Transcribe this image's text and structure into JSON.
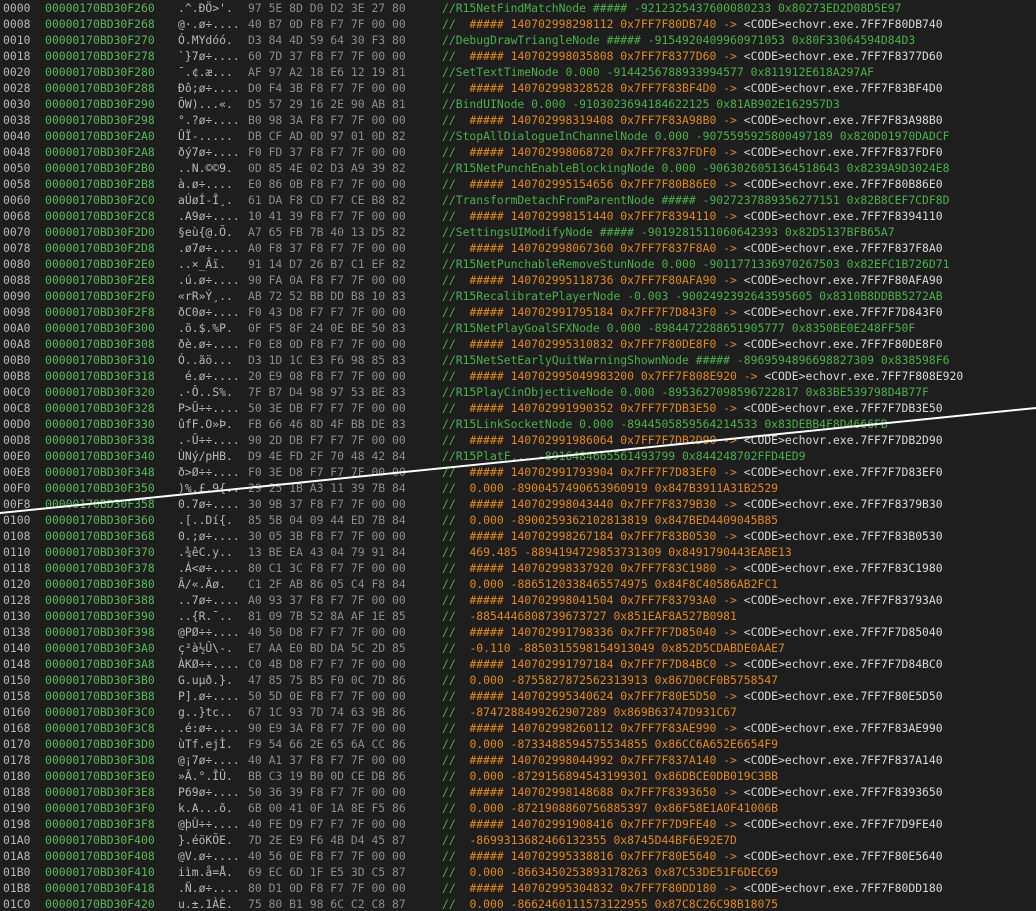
{
  "colors": {
    "background": "#1e1e1e",
    "offset": "#b8b8b8",
    "address": "#59b85b",
    "ascii": "#b8b8b8",
    "hex": "#8c8c8c",
    "comment_green": "#4cb04a",
    "comment_orange": "#e0891e",
    "comment_white": "#d9d9d9",
    "overlay_line": "#ffffff"
  },
  "rows": [
    {
      "off": "0000",
      "addr": "00000170BD30F260",
      "ascii": ".^.ĐÖ>'.",
      "hex": "97 5E 8D D0 D2 3E 27 80",
      "cmt": [
        [
          "//R15NetFindMatchNode ##### -9212325437600080233 0x80273ED2D08D5E97",
          "g"
        ]
      ]
    },
    {
      "off": "0008",
      "addr": "00000170BD30F268",
      "ascii": "@·.ø÷....",
      "hex": "40 B7 0D F8 F7 7F 00 00",
      "cmt": [
        [
          "//  ",
          "g"
        ],
        [
          "##### 140702998298112 0x7FF7F80DB740 -> ",
          "o"
        ],
        [
          "<CODE>echovr.exe.7FF7F80DB740",
          "w"
        ]
      ]
    },
    {
      "off": "0010",
      "addr": "00000170BD30F270",
      "ascii": "Ó.MYdóó.",
      "hex": "D3 84 4D 59 64 30 F3 80",
      "cmt": [
        [
          "//DebugDrawTriangleNode ##### -9154920409960971053 0x80F33064594D84D3",
          "g"
        ]
      ]
    },
    {
      "off": "0018",
      "addr": "00000170BD30F278",
      "ascii": "`}7ø÷....",
      "hex": "60 7D 37 F8 F7 7F 00 00",
      "cmt": [
        [
          "//  ",
          "g"
        ],
        [
          "##### 140702998035808 0x7FF7F8377D60 -> ",
          "o"
        ],
        [
          "<CODE>echovr.exe.7FF7F8377D60",
          "w"
        ]
      ]
    },
    {
      "off": "0020",
      "addr": "00000170BD30F280",
      "ascii": "¯.¢.æ...",
      "hex": "AF 97 A2 18 E6 12 19 81",
      "cmt": [
        [
          "//SetTextTimeNode 0.000 -9144256788933994577 0x811912E618A297AF",
          "g"
        ]
      ]
    },
    {
      "off": "0028",
      "addr": "00000170BD30F288",
      "ascii": "Ðô;ø÷....",
      "hex": "D0 F4 3B F8 F7 7F 00 00",
      "cmt": [
        [
          "//  ",
          "g"
        ],
        [
          "##### 140702998328528 0x7FF7F83BF4D0 -> ",
          "o"
        ],
        [
          "<CODE>echovr.exe.7FF7F83BF4D0",
          "w"
        ]
      ]
    },
    {
      "off": "0030",
      "addr": "00000170BD30F290",
      "ascii": "ÕW)...«.",
      "hex": "D5 57 29 16 2E 90 AB 81",
      "cmt": [
        [
          "//BindUINode 0.000 -9103023694184622125 0x81AB902E162957D3",
          "g"
        ]
      ]
    },
    {
      "off": "0038",
      "addr": "00000170BD30F298",
      "ascii": "°.?ø÷....",
      "hex": "B0 98 3A F8 F7 7F 00 00",
      "cmt": [
        [
          "//  ",
          "g"
        ],
        [
          "##### 140702998319408 0x7FF7F83A98B0 -> ",
          "o"
        ],
        [
          "<CODE>echovr.exe.7FF7F83A98B0",
          "w"
        ]
      ]
    },
    {
      "off": "0040",
      "addr": "00000170BD30F2A0",
      "ascii": "ÛÏ-.....",
      "hex": "DB CF AD 0D 97 01 0D 82",
      "cmt": [
        [
          "//StopAllDialogueInChannelNode 0.000 -9075595925800497189 0x820D01970DADCF",
          "g"
        ]
      ]
    },
    {
      "off": "0048",
      "addr": "00000170BD30F2A8",
      "ascii": "ðý7ø÷....",
      "hex": "F0 FD 37 F8 F7 7F 00 00",
      "cmt": [
        [
          "//  ",
          "g"
        ],
        [
          "##### 140702998068720 0x7FF7F837FDF0 -> ",
          "o"
        ],
        [
          "<CODE>echovr.exe.7FF7F837FDF0",
          "w"
        ]
      ]
    },
    {
      "off": "0050",
      "addr": "00000170BD30F2B0",
      "ascii": "..N.©©9.",
      "hex": "0D 85 4E 02 D3 A9 39 82",
      "cmt": [
        [
          "//R15NetPunchEnableBlockingNode 0.000 -9063026051364518643 0x8239A9D3024E8",
          "g"
        ]
      ]
    },
    {
      "off": "0058",
      "addr": "00000170BD30F2B8",
      "ascii": "à.ø÷....",
      "hex": "E0 86 0B F8 F7 7F 00 00",
      "cmt": [
        [
          "//  ",
          "g"
        ],
        [
          "##### 140702995154656 0x7FF7F80B86E0 -> ",
          "o"
        ],
        [
          "<CODE>echovr.exe.7FF7F80B86E0",
          "w"
        ]
      ]
    },
    {
      "off": "0060",
      "addr": "00000170BD30F2C0",
      "ascii": "aÚøÍ-Î¸.",
      "hex": "61 DA F8 CD F7 CE B8 82",
      "cmt": [
        [
          "//TransformDetachFromParentNode ##### -9027237889356277151 0x82B8CEF7CDF8D",
          "g"
        ]
      ]
    },
    {
      "off": "0068",
      "addr": "00000170BD30F2C8",
      "ascii": ".A9ø÷....",
      "hex": "10 41 39 F8 F7 7F 00 00",
      "cmt": [
        [
          "//  ",
          "g"
        ],
        [
          "##### 140702998151440 0x7FF7F8394110 -> ",
          "o"
        ],
        [
          "<CODE>echovr.exe.7FF7F8394110",
          "w"
        ]
      ]
    },
    {
      "off": "0070",
      "addr": "00000170BD30F2D0",
      "ascii": "§eù{@.Õ.",
      "hex": "A7 65 FB 7B 40 13 D5 82",
      "cmt": [
        [
          "//SettingsUIModifyNode ##### -9019281511060642393 0x82D5137BFB65A7",
          "g"
        ]
      ]
    },
    {
      "off": "0078",
      "addr": "00000170BD30F2D8",
      "ascii": ".ø7ø÷....",
      "hex": "A0 F8 37 F8 F7 7F 00 00",
      "cmt": [
        [
          "//  ",
          "g"
        ],
        [
          "##### 140702998067360 0x7FF7F837F8A0 -> ",
          "o"
        ],
        [
          "<CODE>echovr.exe.7FF7F837F8A0",
          "w"
        ]
      ]
    },
    {
      "off": "0080",
      "addr": "00000170BD30F2E0",
      "ascii": "..×_Âï.",
      "hex": "91 14 D7 26 B7 C1 EF 82",
      "cmt": [
        [
          "//R15NetPunchableRemoveStunNode 0.000 -9011771336970267503 0x82EFC1B726D71",
          "g"
        ]
      ]
    },
    {
      "off": "0088",
      "addr": "00000170BD30F2E8",
      "ascii": ".ú.ø÷....",
      "hex": "90 FA 0A F8 F7 7F 00 00",
      "cmt": [
        [
          "//  ",
          "g"
        ],
        [
          "##### 140702995118736 0x7FF7F80AFA90 -> ",
          "o"
        ],
        [
          "<CODE>echovr.exe.7FF7F80AFA90",
          "w"
        ]
      ]
    },
    {
      "off": "0090",
      "addr": "00000170BD30F2F0",
      "ascii": "«rR»Ý¸..",
      "hex": "AB 72 52 BB DD B8 10 83",
      "cmt": [
        [
          "//R15RecalibratePlayerNode -0.003 -9002492392643595605 0x8310B8DDBB5272AB",
          "g"
        ]
      ]
    },
    {
      "off": "0098",
      "addr": "00000170BD30F2F8",
      "ascii": "ðC0ø÷....",
      "hex": "F0 43 D8 F7 F7 7F 00 00",
      "cmt": [
        [
          "//  ",
          "g"
        ],
        [
          "##### 140702991795184 0x7FF7F7D843F0 -> ",
          "o"
        ],
        [
          "<CODE>echovr.exe.7FF7F7D843F0",
          "w"
        ]
      ]
    },
    {
      "off": "00A0",
      "addr": "00000170BD30F300",
      "ascii": ".õ.$.%P.",
      "hex": "0F F5 8F 24 0E BE 50 83",
      "cmt": [
        [
          "//R15NetPlayGoalSFXNode 0.000 -8984472288651905777 0x8350BE0E248FF50F",
          "g"
        ]
      ]
    },
    {
      "off": "00A8",
      "addr": "00000170BD30F308",
      "ascii": "ðè.ø÷....",
      "hex": "F0 E8 0D F8 F7 7F 00 00",
      "cmt": [
        [
          "//  ",
          "g"
        ],
        [
          "##### 140702995310832 0x7FF7F80DE8F0 -> ",
          "o"
        ],
        [
          "<CODE>echovr.exe.7FF7F80DE8F0",
          "w"
        ]
      ]
    },
    {
      "off": "00B0",
      "addr": "00000170BD30F310",
      "ascii": "Ó..ãö...",
      "hex": "D3 1D 1C E3 F6 98 85 83",
      "cmt": [
        [
          "//R15NetSetEarlyQuitWarningShownNode ##### -8969594896698827309 0x838598F6",
          "g"
        ]
      ]
    },
    {
      "off": "00B8",
      "addr": "00000170BD30F318",
      "ascii": " é.ø÷....",
      "hex": "20 E9 08 F8 F7 7F 00 00",
      "cmt": [
        [
          "//  ",
          "g"
        ],
        [
          "##### 140702995049983200 0x7FF7F808E920 -> ",
          "o"
        ],
        [
          "<CODE>echovr.exe.7FF7F808E920",
          "w"
        ]
      ]
    },
    {
      "off": "00C0",
      "addr": "00000170BD30F320",
      "ascii": ".·Ô..S%.",
      "hex": "7F B7 D4 98 97 53 BE 83",
      "cmt": [
        [
          "//R15PlayCinObjectiveNode 0.000 -8953627098596722817 0x83BE539798D4B77F",
          "g"
        ]
      ]
    },
    {
      "off": "00C8",
      "addr": "00000170BD30F328",
      "ascii": "P>Û÷÷....",
      "hex": "50 3E DB F7 F7 7F 00 00",
      "cmt": [
        [
          "//  ",
          "g"
        ],
        [
          "##### 140702991990352 0x7FF7F7DB3E50 -> ",
          "o"
        ],
        [
          "<CODE>echovr.exe.7FF7F7DB3E50",
          "w"
        ]
      ]
    },
    {
      "off": "00D0",
      "addr": "00000170BD30F330",
      "ascii": "ûfF.O»Þ.",
      "hex": "FB 66 46 8D 4F BB DE 83",
      "cmt": [
        [
          "//R15LinkSocketNode 0.000 -8944505859564214533 0x83DEBB4F8D4666FB",
          "g"
        ]
      ]
    },
    {
      "off": "00D8",
      "addr": "00000170BD30F338",
      "ascii": ".-Û÷÷....",
      "hex": "90 2D DB F7 F7 7F 00 00",
      "cmt": [
        [
          "//  ",
          "g"
        ],
        [
          "##### 140702991986064 0x7FF7F7DB2D90 -> ",
          "o"
        ],
        [
          "<CODE>echovr.exe.7FF7F7DB2D90",
          "w"
        ]
      ]
    },
    {
      "off": "00E0",
      "addr": "00000170BD30F340",
      "ascii": "ÙNý/pHB.",
      "hex": "D9 4E FD 2F 70 48 42 84",
      "cmt": [
        [
          "//R15PlatF... -8916484665561493799 0x844248702FFD4ED9",
          "g"
        ]
      ]
    },
    {
      "off": "00E8",
      "addr": "00000170BD30F348",
      "ascii": "ð>Ø÷÷....",
      "hex": "F0 3E D8 F7 F7 7F 00 00",
      "cmt": [
        [
          "//  ",
          "g"
        ],
        [
          "##### 140702991793904 0x7FF7F7D83EF0 -> ",
          "o"
        ],
        [
          "<CODE>echovr.exe.7FF7F7D83EF0",
          "w"
        ]
      ]
    },
    {
      "off": "00F0",
      "addr": "00000170BD30F350",
      "ascii": ")%.£.9{..",
      "hex": "29 25 1B A3 11 39 7B 84",
      "cmt": [
        [
          "//  ",
          "g"
        ],
        [
          "0.000 -8900457490653960919 0x847B3911A31B2529",
          "o"
        ]
      ]
    },
    {
      "off": "00F8",
      "addr": "00000170BD30F358",
      "ascii": "0.7ø÷....",
      "hex": "30 9B 37 F8 F7 7F 00 00",
      "cmt": [
        [
          "//  ",
          "g"
        ],
        [
          "##### 140702998043440 0x7FF7F8379B30 -> ",
          "o"
        ],
        [
          "<CODE>echovr.exe.7FF7F8379B30",
          "w"
        ]
      ]
    },
    {
      "off": "0100",
      "addr": "00000170BD30F360",
      "ascii": ".[..Dí{.",
      "hex": "85 5B 04 09 44 ED 7B 84",
      "cmt": [
        [
          "//  ",
          "g"
        ],
        [
          "0.000 -8900259362102813819 0x847BED4409045B85",
          "o"
        ]
      ]
    },
    {
      "off": "0108",
      "addr": "00000170BD30F368",
      "ascii": "0.;ø÷....",
      "hex": "30 05 3B F8 F7 7F 00 00",
      "cmt": [
        [
          "//  ",
          "g"
        ],
        [
          "##### 140702998267184 0x7FF7F83B0530 -> ",
          "o"
        ],
        [
          "<CODE>echovr.exe.7FF7F83B0530",
          "w"
        ]
      ]
    },
    {
      "off": "0110",
      "addr": "00000170BD30F370",
      "ascii": ".¾êC.y..",
      "hex": "13 BE EA 43 04 79 91 84",
      "cmt": [
        [
          "//  ",
          "g"
        ],
        [
          "469.485 -8894194729853731309 0x8491790443EABE13",
          "o"
        ]
      ]
    },
    {
      "off": "0118",
      "addr": "00000170BD30F378",
      "ascii": ".Á<ø÷....",
      "hex": "80 C1 3C F8 F7 7F 00 00",
      "cmt": [
        [
          "//  ",
          "g"
        ],
        [
          "##### 140702998337920 0x7FF7F83C1980 -> ",
          "o"
        ],
        [
          "<CODE>echovr.exe.7FF7F83C1980",
          "w"
        ]
      ]
    },
    {
      "off": "0120",
      "addr": "00000170BD30F380",
      "ascii": "Â/«.Äø.",
      "hex": "C1 2F AB 86 05 C4 F8 84",
      "cmt": [
        [
          "//  ",
          "g"
        ],
        [
          "0.000 -8865120338465574975 0x84F8C40586AB2FC1",
          "o"
        ]
      ]
    },
    {
      "off": "0128",
      "addr": "00000170BD30F388",
      "ascii": "..7ø÷....",
      "hex": "A0 93 37 F8 F7 7F 00 00",
      "cmt": [
        [
          "//  ",
          "g"
        ],
        [
          "##### 140702998041504 0x7FF7F83793A0 -> ",
          "o"
        ],
        [
          "<CODE>echovr.exe.7FF7F83793A0",
          "w"
        ]
      ]
    },
    {
      "off": "0130",
      "addr": "00000170BD30F390",
      "ascii": "..{R.¯..",
      "hex": "81 09 7B 52 8A AF 1E 85",
      "cmt": [
        [
          "//  ",
          "g"
        ],
        [
          "-8854446808739673727 0x851EAF8A527B0981",
          "o"
        ]
      ]
    },
    {
      "off": "0138",
      "addr": "00000170BD30F398",
      "ascii": "@PØ÷÷....",
      "hex": "40 50 D8 F7 F7 7F 00 00",
      "cmt": [
        [
          "//  ",
          "g"
        ],
        [
          "##### 140702991798336 0x7FF7F7D85040 -> ",
          "o"
        ],
        [
          "<CODE>echovr.exe.7FF7F7D85040",
          "w"
        ]
      ]
    },
    {
      "off": "0140",
      "addr": "00000170BD30F3A0",
      "ascii": "ç²à½Û\\-.",
      "hex": "E7 AA E0 BD DA 5C 2D 85",
      "cmt": [
        [
          "//  ",
          "g"
        ],
        [
          "-0.110 -8850315598154913049 0x852D5CDABDE0AAE7",
          "o"
        ]
      ]
    },
    {
      "off": "0148",
      "addr": "00000170BD30F3A8",
      "ascii": "ÀKØ÷÷....",
      "hex": "C0 4B D8 F7 F7 7F 00 00",
      "cmt": [
        [
          "//  ",
          "g"
        ],
        [
          "##### 140702991797184 0x7FF7F7D84BC0 -> ",
          "o"
        ],
        [
          "<CODE>echovr.exe.7FF7F7D84BC0",
          "w"
        ]
      ]
    },
    {
      "off": "0150",
      "addr": "00000170BD30F3B0",
      "ascii": "G.uµð.}.",
      "hex": "47 85 75 B5 F0 0C 7D 86",
      "cmt": [
        [
          "//  ",
          "g"
        ],
        [
          "0.000 -8755827872562313913 0x867D0CF0B5758547",
          "o"
        ]
      ]
    },
    {
      "off": "0158",
      "addr": "00000170BD30F3B8",
      "ascii": "P].ø÷....",
      "hex": "50 5D 0E F8 F7 7F 00 00",
      "cmt": [
        [
          "//  ",
          "g"
        ],
        [
          "##### 140702995340624 0x7FF7F80E5D50 -> ",
          "o"
        ],
        [
          "<CODE>echovr.exe.7FF7F80E5D50",
          "w"
        ]
      ]
    },
    {
      "off": "0160",
      "addr": "00000170BD30F3C0",
      "ascii": "g..}tc..",
      "hex": "67 1C 93 7D 74 63 9B 86",
      "cmt": [
        [
          "//  ",
          "g"
        ],
        [
          "-8747288499262907289 0x869B63747D931C67",
          "o"
        ]
      ]
    },
    {
      "off": "0168",
      "addr": "00000170BD30F3C8",
      "ascii": ".é:ø÷....",
      "hex": "90 E9 3A F8 F7 7F 00 00",
      "cmt": [
        [
          "//  ",
          "g"
        ],
        [
          "##### 140702998260112 0x7FF7F83AE990 -> ",
          "o"
        ],
        [
          "<CODE>echovr.exe.7FF7F83AE990",
          "w"
        ]
      ]
    },
    {
      "off": "0170",
      "addr": "00000170BD30F3D0",
      "ascii": "ùTf.ejÌ.",
      "hex": "F9 54 66 2E 65 6A CC 86",
      "cmt": [
        [
          "//  ",
          "g"
        ],
        [
          "0.000 -8733488594575534855 0x86CC6A652E6654F9",
          "o"
        ]
      ]
    },
    {
      "off": "0178",
      "addr": "00000170BD30F3D8",
      "ascii": "@¡7ø÷....",
      "hex": "40 A1 37 F8 F7 7F 00 00",
      "cmt": [
        [
          "//  ",
          "g"
        ],
        [
          "##### 140702998044992 0x7FF7F837A140 -> ",
          "o"
        ],
        [
          "<CODE>echovr.exe.7FF7F837A140",
          "w"
        ]
      ]
    },
    {
      "off": "0180",
      "addr": "00000170BD30F3E0",
      "ascii": "»Ã.°.ÎÛ.",
      "hex": "BB C3 19 B0 0D CE DB 86",
      "cmt": [
        [
          "//  ",
          "g"
        ],
        [
          "0.000 -8729156894543199301 0x86DBCE0DB019C3BB",
          "o"
        ]
      ]
    },
    {
      "off": "0188",
      "addr": "00000170BD30F3E8",
      "ascii": "P69ø÷....",
      "hex": "50 36 39 F8 F7 7F 00 00",
      "cmt": [
        [
          "//  ",
          "g"
        ],
        [
          "##### 140702998148688 0x7FF7F8393650 -> ",
          "o"
        ],
        [
          "<CODE>echovr.exe.7FF7F8393650",
          "w"
        ]
      ]
    },
    {
      "off": "0190",
      "addr": "00000170BD30F3F0",
      "ascii": "k.A...õ.",
      "hex": "6B 00 41 0F 1A 8E F5 86",
      "cmt": [
        [
          "//  ",
          "g"
        ],
        [
          "0.000 -8721908860756885397 0x86F58E1A0F41006B",
          "o"
        ]
      ]
    },
    {
      "off": "0198",
      "addr": "00000170BD30F3F8",
      "ascii": "@þÙ÷÷....",
      "hex": "40 FE D9 F7 F7 7F 00 00",
      "cmt": [
        [
          "//  ",
          "g"
        ],
        [
          "##### 140702991908416 0x7FF7F7D9FE40 -> ",
          "o"
        ],
        [
          "<CODE>echovr.exe.7FF7F7D9FE40",
          "w"
        ]
      ]
    },
    {
      "off": "01A0",
      "addr": "00000170BD30F400",
      "ascii": "}.éöKÕE.",
      "hex": "7D 2E E9 F6 4B D4 45 87",
      "cmt": [
        [
          "//  ",
          "g"
        ],
        [
          "-8699313682466132355 0x8745D44BF6E92E7D",
          "o"
        ]
      ]
    },
    {
      "off": "01A8",
      "addr": "00000170BD30F408",
      "ascii": "@V.ø÷....",
      "hex": "40 56 0E F8 F7 7F 00 00",
      "cmt": [
        [
          "//  ",
          "g"
        ],
        [
          "##### 140702995338816 0x7FF7F80E5640 -> ",
          "o"
        ],
        [
          "<CODE>echovr.exe.7FF7F80E5640",
          "w"
        ]
      ]
    },
    {
      "off": "01B0",
      "addr": "00000170BD30F410",
      "ascii": "iìm.å=Å.",
      "hex": "69 EC 6D 1F E5 3D C5 87",
      "cmt": [
        [
          "//  ",
          "g"
        ],
        [
          "0.000 -8663450253893178263 0x87C53DE51F6DEC69",
          "o"
        ]
      ]
    },
    {
      "off": "01B8",
      "addr": "00000170BD30F418",
      "ascii": ".Ñ.ø÷....",
      "hex": "80 D1 0D F8 F7 7F 00 00",
      "cmt": [
        [
          "//  ",
          "g"
        ],
        [
          "##### 140702995304832 0x7FF7F80DD180 -> ",
          "o"
        ],
        [
          "<CODE>echovr.exe.7FF7F80DD180",
          "w"
        ]
      ]
    },
    {
      "off": "01C0",
      "addr": "00000170BD30F420",
      "ascii": "u.±.1ÀÈ.",
      "hex": "75 80 B1 98 6C C2 C8 87",
      "cmt": [
        [
          "//  ",
          "g"
        ],
        [
          "0.000 -8662460111573122955 0x87C8C26C98B18075",
          "o"
        ]
      ]
    }
  ]
}
